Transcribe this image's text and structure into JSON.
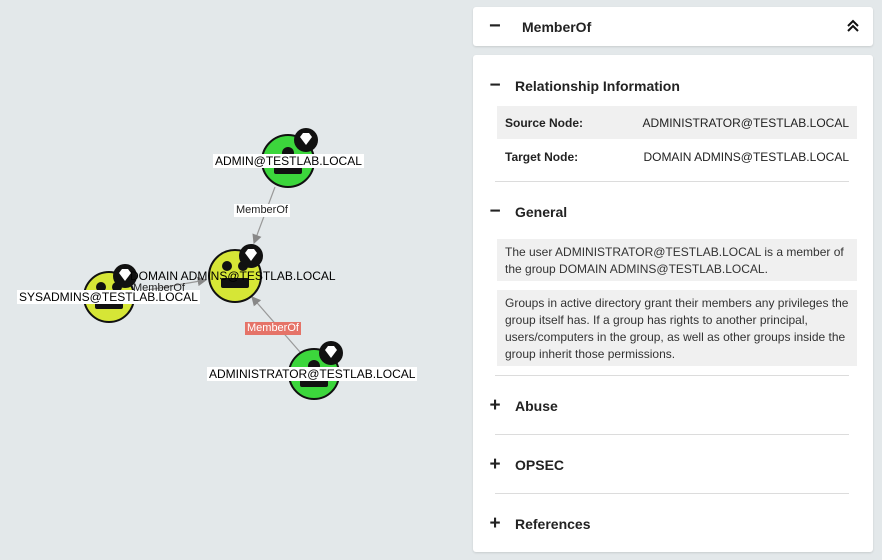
{
  "graph": {
    "nodes": [
      {
        "id": "admin",
        "label": "ADMIN@TESTLAB.LOCAL",
        "color": "#3cd63c",
        "icon": "user-icon",
        "badge": "diamond-icon"
      },
      {
        "id": "domainadmins",
        "label": "DOMAIN ADMINS@TESTLAB.LOCAL",
        "color": "#d6e636",
        "icon": "group-icon",
        "badge": "diamond-icon"
      },
      {
        "id": "sysadmins",
        "label": "SYSADMINS@TESTLAB.LOCAL",
        "color": "#d6e636",
        "icon": "group-icon",
        "badge": "diamond-icon"
      },
      {
        "id": "administrator",
        "label": "ADMINISTRATOR@TESTLAB.LOCAL",
        "color": "#3cd63c",
        "icon": "user-icon",
        "badge": "diamond-icon"
      }
    ],
    "edges": [
      {
        "from": "admin",
        "to": "domainadmins",
        "label": "MemberOf",
        "selected": false
      },
      {
        "from": "sysadmins",
        "to": "domainadmins",
        "label": "MemberOf",
        "selected": false
      },
      {
        "from": "administrator",
        "to": "domainadmins",
        "label": "MemberOf",
        "selected": true
      }
    ]
  },
  "header": {
    "title": "MemberOf",
    "toggle": "−",
    "collapse_icon": "double-chevron-up-icon"
  },
  "relationship": {
    "title": "Relationship Information",
    "toggle": "−",
    "source_key": "Source Node:",
    "source_value": "ADMINISTRATOR@TESTLAB.LOCAL",
    "target_key": "Target Node:",
    "target_value": "DOMAIN ADMINS@TESTLAB.LOCAL"
  },
  "general": {
    "title": "General",
    "toggle": "−",
    "paragraph1": "The user ADMINISTRATOR@TESTLAB.LOCAL is a member of the group DOMAIN ADMINS@TESTLAB.LOCAL.",
    "paragraph2": "Groups in active directory grant their members any privileges the group itself has. If a group has rights to another principal, users/computers in the group, as well as other groups inside the group inherit those permissions."
  },
  "collapsed_sections": [
    {
      "title": "Abuse",
      "toggle": "+"
    },
    {
      "title": "OPSEC",
      "toggle": "+"
    },
    {
      "title": "References",
      "toggle": "+"
    }
  ],
  "colors": {
    "background": "#e3e8ea",
    "user_node": "#3cd63c",
    "group_node": "#d6e636",
    "selected_edge": "#e57368"
  }
}
